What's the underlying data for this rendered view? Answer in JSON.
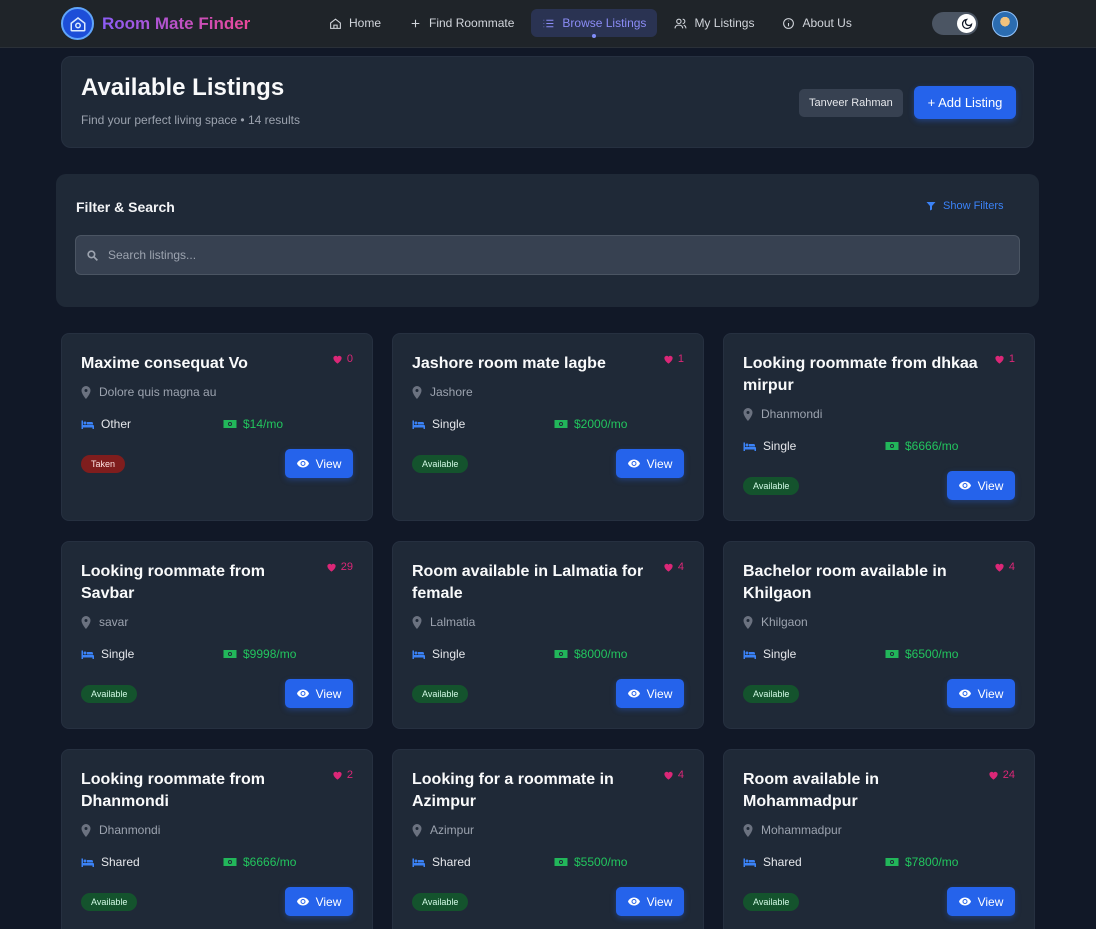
{
  "nav": {
    "brand": "Room Mate Finder",
    "links": [
      {
        "label": "Home",
        "icon": "home-icon"
      },
      {
        "label": "Find Roommate",
        "icon": "plus-icon"
      },
      {
        "label": "Browse Listings",
        "icon": "list-icon",
        "active": true
      },
      {
        "label": "My Listings",
        "icon": "users-icon"
      },
      {
        "label": "About Us",
        "icon": "info-icon"
      }
    ],
    "theme": "dark"
  },
  "header": {
    "title": "Available Listings",
    "subtitle": "Find your perfect living space • 14 results",
    "user_name": "Tanveer Rahman",
    "add_button": "+ Add Listing"
  },
  "filter": {
    "title": "Filter & Search",
    "toggle_label": "Show Filters",
    "search_placeholder": "Search listings...",
    "search_value": ""
  },
  "view_label": "View",
  "listings": [
    {
      "title": "Maxime consequat Vo",
      "likes": "0",
      "location": "Dolore quis magna au",
      "room_type": "Other",
      "price": "$14/mo",
      "status": "Taken"
    },
    {
      "title": "Jashore room mate lagbe",
      "likes": "1",
      "location": "Jashore",
      "room_type": "Single",
      "price": "$2000/mo",
      "status": "Available"
    },
    {
      "title": "Looking roommate from dhkaa mirpur",
      "likes": "1",
      "location": "Dhanmondi",
      "room_type": "Single",
      "price": "$6666/mo",
      "status": "Available"
    },
    {
      "title": "Looking roommate from Savbar",
      "likes": "29",
      "location": "savar",
      "room_type": "Single",
      "price": "$9998/mo",
      "status": "Available"
    },
    {
      "title": "Room available in Lalmatia for female",
      "likes": "4",
      "location": "Lalmatia",
      "room_type": "Single",
      "price": "$8000/mo",
      "status": "Available"
    },
    {
      "title": "Bachelor room available in Khilgaon",
      "likes": "4",
      "location": "Khilgaon",
      "room_type": "Single",
      "price": "$6500/mo",
      "status": "Available"
    },
    {
      "title": "Looking roommate from Dhanmondi",
      "likes": "2",
      "location": "Dhanmondi",
      "room_type": "Shared",
      "price": "$6666/mo",
      "status": "Available"
    },
    {
      "title": "Looking for a roommate in Azimpur",
      "likes": "4",
      "location": "Azimpur",
      "room_type": "Shared",
      "price": "$5500/mo",
      "status": "Available"
    },
    {
      "title": "Room available in Mohammadpur",
      "likes": "24",
      "location": "Mohammadpur",
      "room_type": "Shared",
      "price": "$7800/mo",
      "status": "Available"
    }
  ],
  "colors": {
    "accent": "#2563eb",
    "available": "#14532d",
    "taken": "#7f1d1d",
    "heart": "#db2777",
    "price": "#22c55e"
  }
}
